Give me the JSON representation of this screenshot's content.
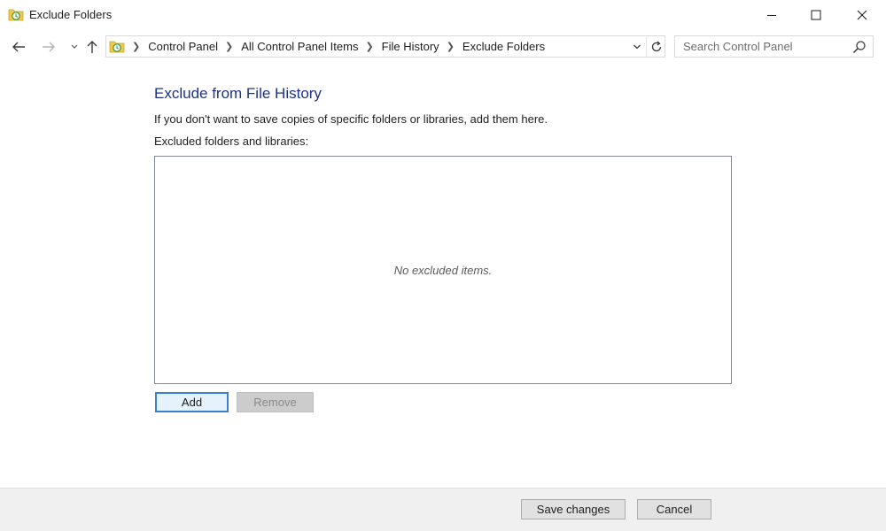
{
  "window": {
    "title": "Exclude Folders",
    "icon": "file-history-icon"
  },
  "navigation": {
    "breadcrumbs": [
      "Control Panel",
      "All Control Panel Items",
      "File History",
      "Exclude Folders"
    ],
    "search_placeholder": "Search Control Panel"
  },
  "content": {
    "heading": "Exclude from File History",
    "description": "If you don't want to save copies of specific folders or libraries, add them here.",
    "list_label": "Excluded folders and libraries:",
    "empty_message": "No excluded items.",
    "add_label": "Add",
    "remove_label": "Remove"
  },
  "footer": {
    "save_label": "Save changes",
    "cancel_label": "Cancel"
  },
  "colors": {
    "heading": "#1e3287",
    "focus_border": "#3c7fd1",
    "footer_bg": "#f0f0f0"
  }
}
